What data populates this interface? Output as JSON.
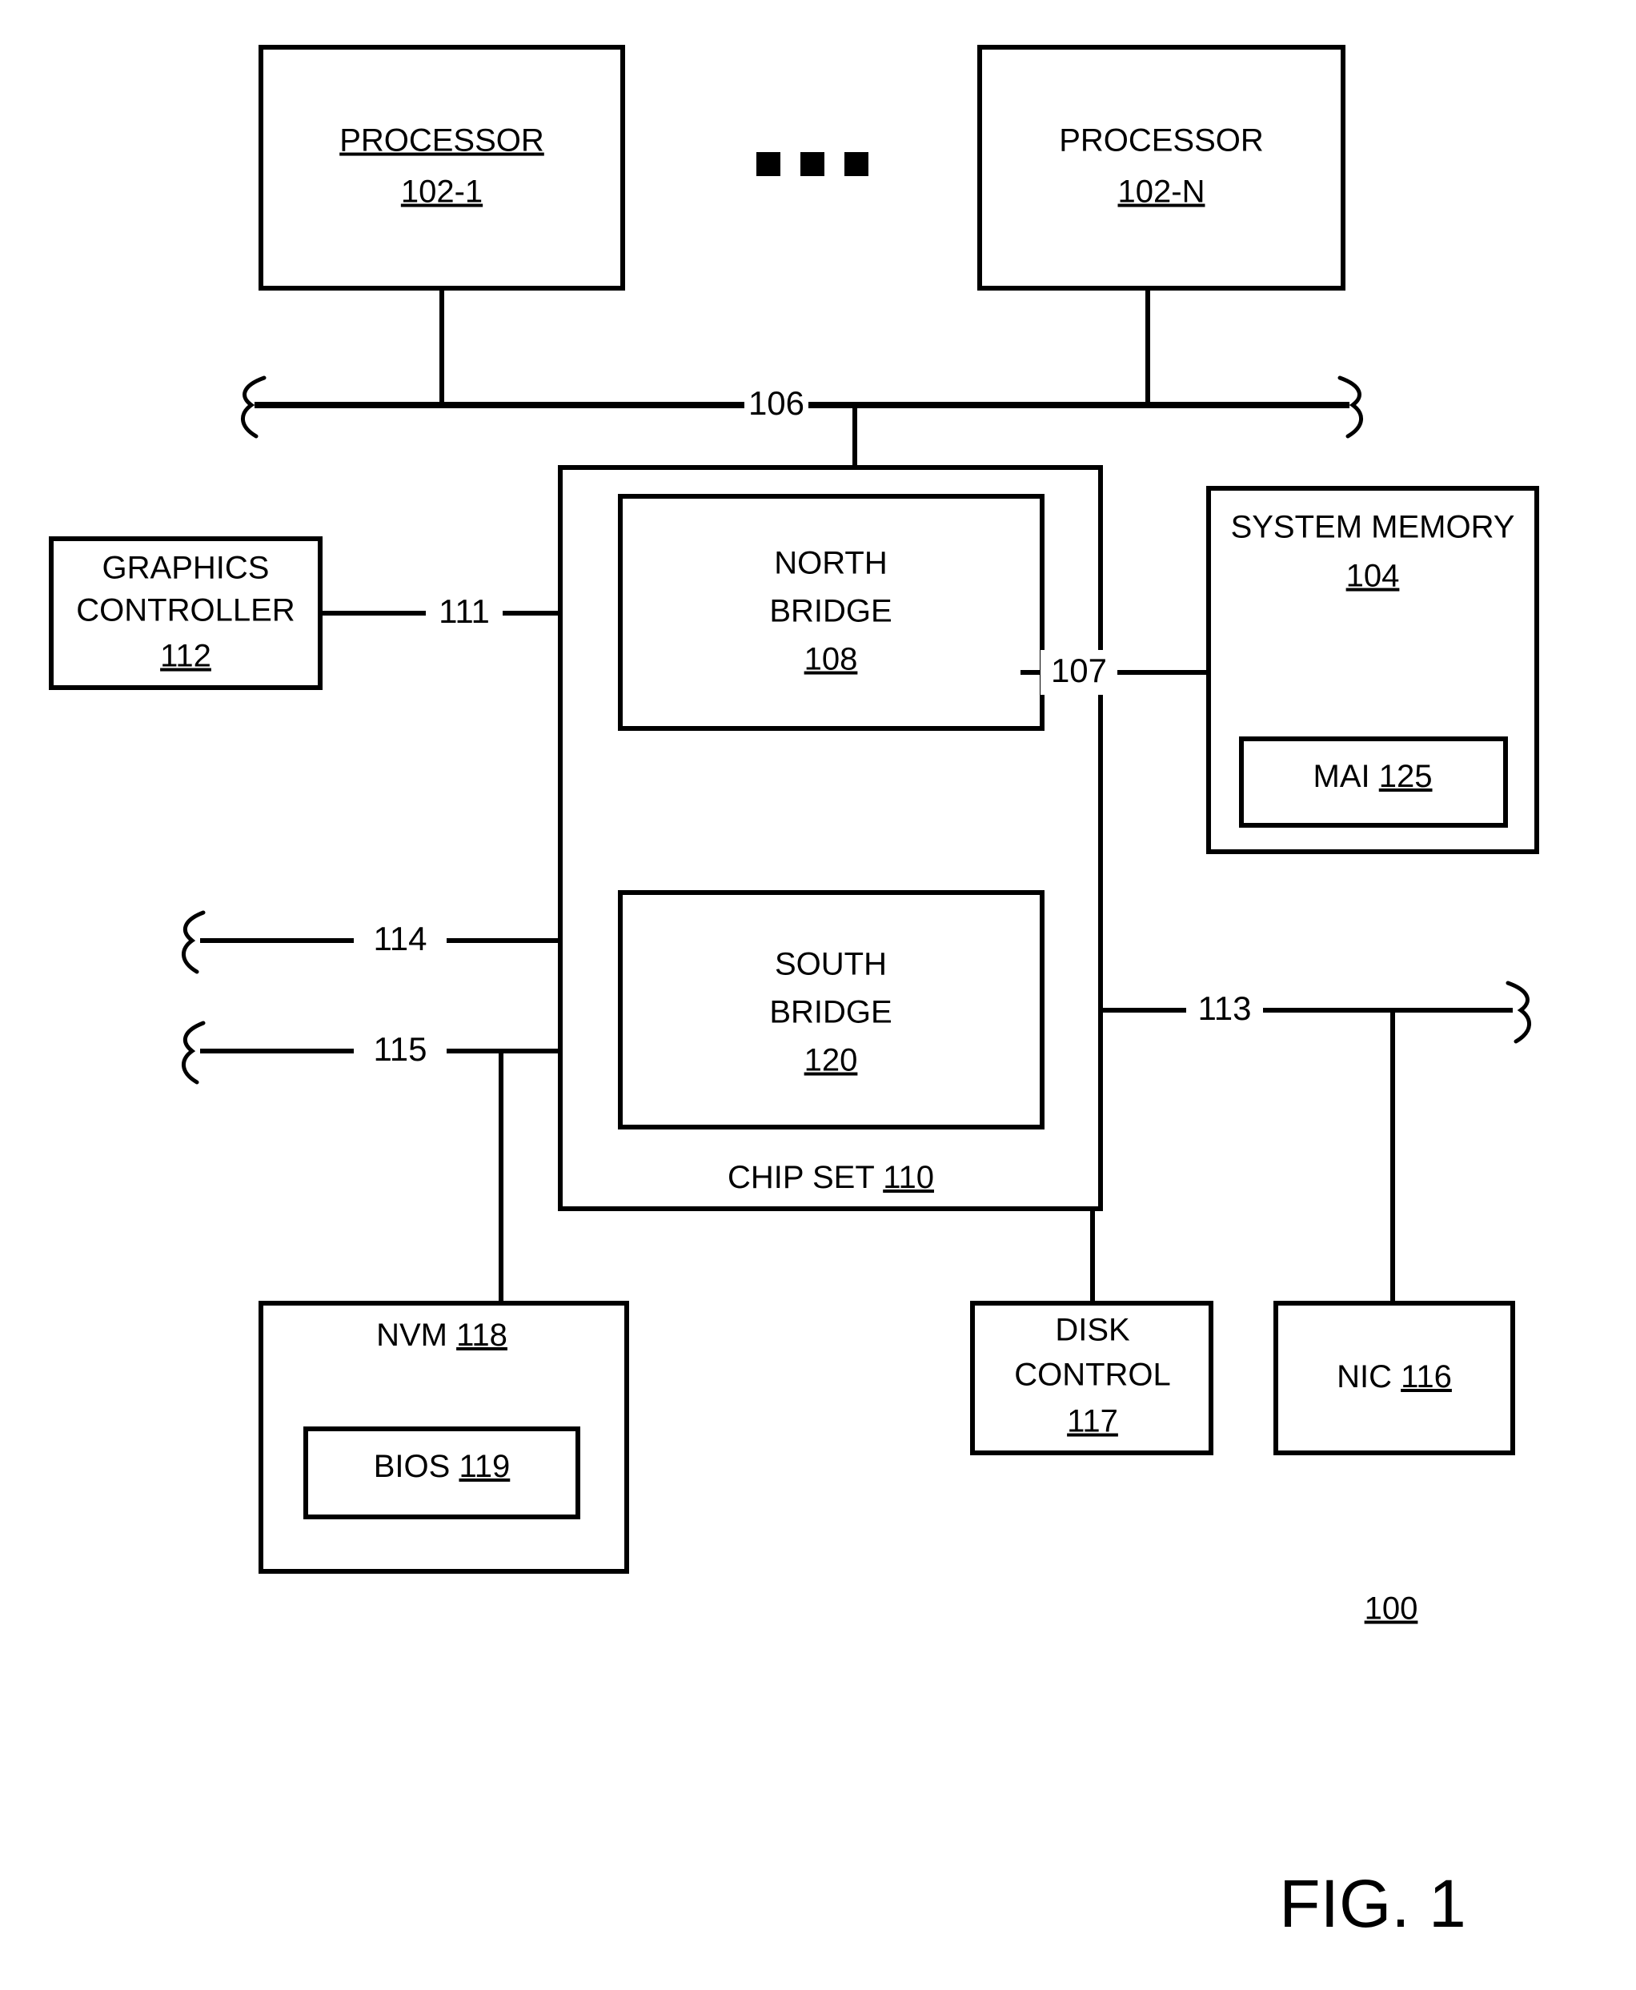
{
  "figure": {
    "title": "FIG. 1",
    "system_ref": "100"
  },
  "blocks": {
    "processor_1": {
      "line1": "PROCESSOR",
      "line2": "102-1"
    },
    "processor_n": {
      "line1": "PROCESSOR",
      "line2": "102-N"
    },
    "graphics_controller": {
      "line1": "GRAPHICS",
      "line2": "CONTROLLER",
      "line3": "112"
    },
    "north_bridge": {
      "line1": "NORTH",
      "line2": "BRIDGE",
      "line3": "108"
    },
    "south_bridge": {
      "line1": "SOUTH",
      "line2": "BRIDGE",
      "line3": "120"
    },
    "chip_set": {
      "line1": "CHIP SET",
      "line2": "110"
    },
    "system_memory": {
      "line1": "SYSTEM MEMORY",
      "line2": "104"
    },
    "mai": {
      "line1": "MAI",
      "line2": "125"
    },
    "nvm": {
      "line1": "NVM",
      "line2": "118"
    },
    "bios": {
      "line1": "BIOS",
      "line2": "119"
    },
    "disk_control": {
      "line1": "DISK",
      "line2": "CONTROL",
      "line3": "117"
    },
    "nic": {
      "line1": "NIC",
      "line2": "116"
    }
  },
  "connections": {
    "bus_106": "106",
    "link_111": "111",
    "link_107": "107",
    "link_114": "114",
    "link_115": "115",
    "bus_113": "113"
  },
  "ellipsis": {
    "symbol": "three-square-dots",
    "count": 3
  },
  "colors": {
    "stroke": "#000000",
    "fill": "#ffffff",
    "background": "#ffffff"
  }
}
